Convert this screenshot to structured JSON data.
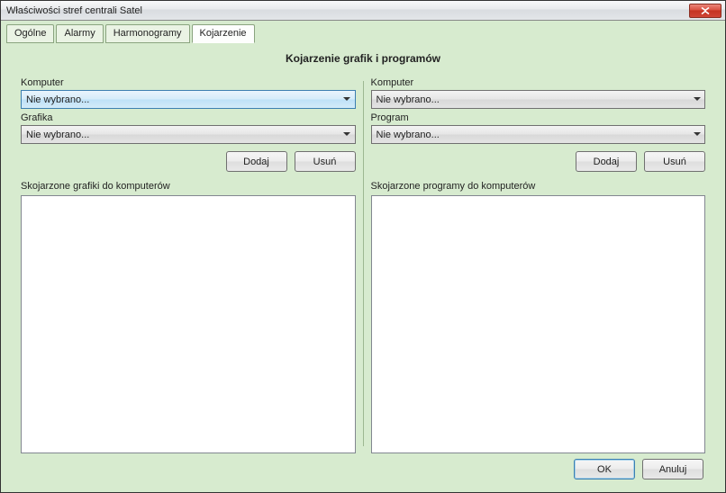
{
  "window": {
    "title": "Właściwości stref centrali Satel"
  },
  "tabs": {
    "items": [
      {
        "label": "Ogólne"
      },
      {
        "label": "Alarmy"
      },
      {
        "label": "Harmonogramy"
      },
      {
        "label": "Kojarzenie"
      }
    ],
    "active_index": 3
  },
  "page": {
    "heading": "Kojarzenie grafik i programów"
  },
  "left": {
    "computer_label": "Komputer",
    "computer_value": "Nie wybrano...",
    "graphic_label": "Grafika",
    "graphic_value": "Nie wybrano...",
    "add_label": "Dodaj",
    "remove_label": "Usuń",
    "list_label": "Skojarzone grafiki do komputerów"
  },
  "right": {
    "computer_label": "Komputer",
    "computer_value": "Nie wybrano...",
    "program_label": "Program",
    "program_value": "Nie wybrano...",
    "add_label": "Dodaj",
    "remove_label": "Usuń",
    "list_label": "Skojarzone programy do komputerów"
  },
  "footer": {
    "ok_label": "OK",
    "cancel_label": "Anuluj"
  }
}
